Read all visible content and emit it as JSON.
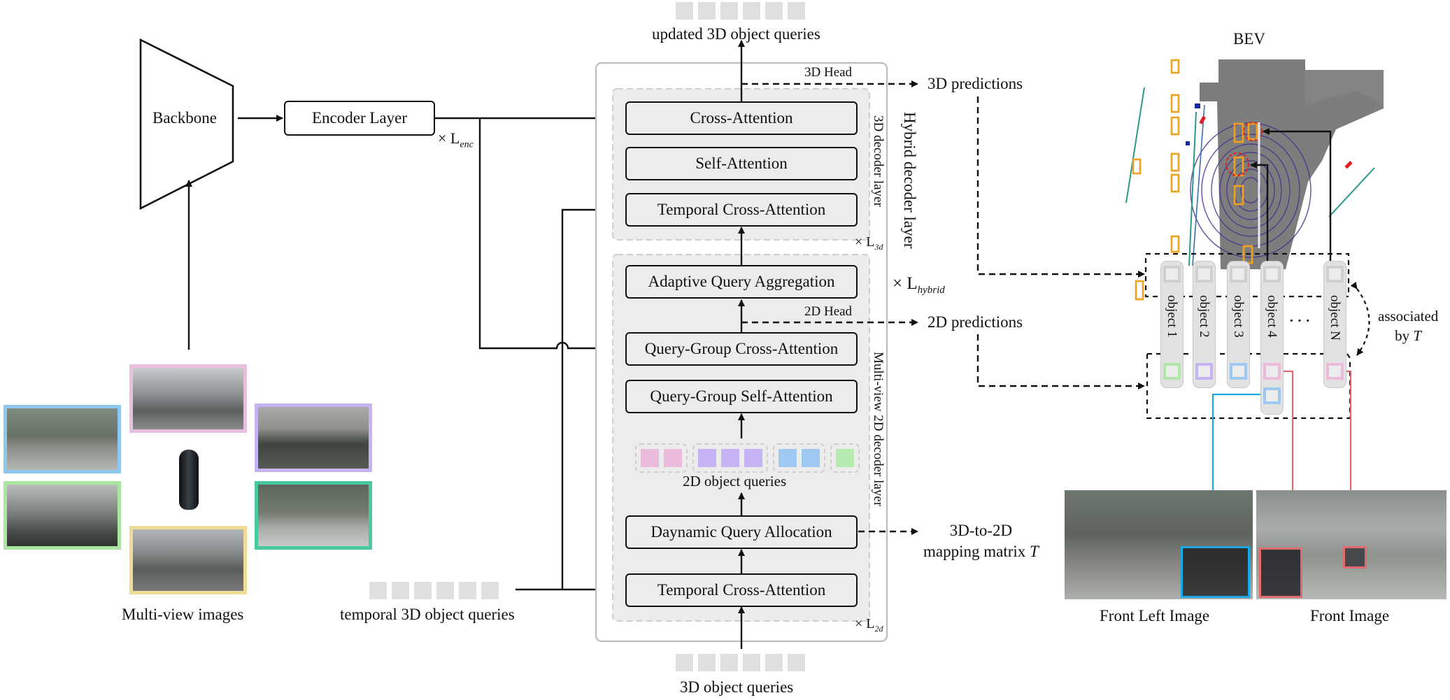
{
  "encoder": {
    "backbone_label": "Backbone",
    "encoder_layer_label": "Encoder Layer",
    "encoder_repeat": "× L",
    "encoder_repeat_sub": "enc"
  },
  "inputs": {
    "multi_view_label": "Multi-view images",
    "multi_view_border_colors": {
      "front": "#e8bfdc",
      "front_left": "#8ec8ef",
      "front_right": "#c5b2f2",
      "back_left": "#a9e6a0",
      "back_right": "#46c9a0",
      "back": "#efdc96"
    },
    "temporal_queries_label": "temporal 3D object queries",
    "object_queries_label": "3D object queries",
    "updated_queries_label": "updated 3D object queries",
    "query_count": 6,
    "query_color": "#dfdfdf"
  },
  "hybrid_decoder": {
    "title": "Hybrid decoder layer",
    "repeat": "× L",
    "repeat_sub": "hybrid",
    "decoder_3d": {
      "title": "3D decoder layer",
      "repeat": "× L",
      "repeat_sub": "3d",
      "blocks": [
        "Cross-Attention",
        "Self-Attention",
        "Temporal Cross-Attention"
      ],
      "head_label": "3D Head"
    },
    "decoder_2d": {
      "title": "Multi-view 2D decoder layer",
      "repeat": "× L",
      "repeat_sub": "2d",
      "blocks": [
        "Adaptive Query Aggregation",
        "Query-Group Cross-Attention",
        "Query-Group Self-Attention",
        "Daynamic Query Allocation",
        "Temporal Cross-Attention"
      ],
      "head_label": "2D Head",
      "queries_label": "2D object queries",
      "query_groups": [
        {
          "color": "#ebbbdc",
          "count": 2
        },
        {
          "color": "#c6b3f4",
          "count": 3
        },
        {
          "color": "#a0c9f1",
          "count": 2
        },
        {
          "color": "#b5ebb0",
          "count": 1
        }
      ]
    }
  },
  "outputs": {
    "pred_3d": "3D predictions",
    "pred_2d": "2D predictions",
    "mapping_line1": "3D-to-2D",
    "mapping_line2": "mapping matrix ",
    "mapping_var": "T"
  },
  "right_panel": {
    "bev_label": "BEV",
    "objects": [
      {
        "label": "object 1",
        "color_2d": "#b3e6aa"
      },
      {
        "label": "object 2",
        "color_2d": "#c6b3f4"
      },
      {
        "label": "object 3",
        "color_2d": "#a0c9f1"
      },
      {
        "label": "object 4",
        "color_2d": "#ebbbdc",
        "extra_color_2d": "#a0c9f1"
      },
      {
        "label": "object N",
        "color_2d": "#ebbbdc"
      }
    ],
    "ellipsis": "· · ·",
    "associated_line1": "associated",
    "associated_line2": "by ",
    "associated_var": "T",
    "front_left_label": "Front Left Image",
    "front_label": "Front Image",
    "link_colors": {
      "blue": "#1aa7e4",
      "red": "#e06a6e"
    }
  }
}
